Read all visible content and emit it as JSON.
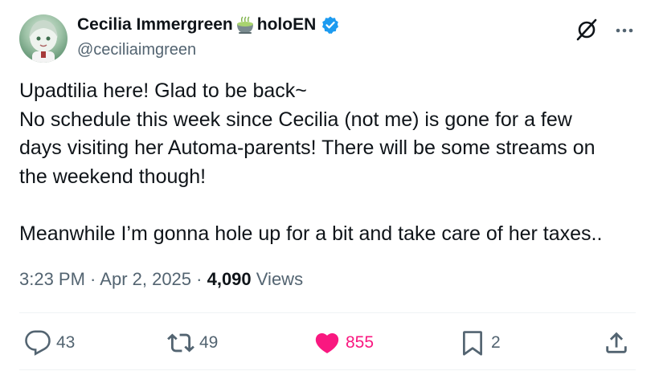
{
  "author": {
    "display_name_part1": "Cecilia Immergreen",
    "emoji": "green-tea-emoji",
    "display_name_part2": "holoEN",
    "handle": "@ceciliaimgreen",
    "verified": true
  },
  "header_icons": [
    "grok-icon",
    "more-icon"
  ],
  "tweet": {
    "lines": [
      "Upadtilia here! Glad to be back~",
      "No schedule this week since Cecilia (not me) is gone for a few",
      "days visiting her Automa-parents! There will be some streams on",
      "the weekend though!",
      "",
      "Meanwhile I’m gonna hole up for a bit and take care of her taxes.."
    ]
  },
  "meta": {
    "time": "3:23 PM",
    "separator": " · ",
    "date": "Apr 2, 2025",
    "views_count": "4,090",
    "views_label": "Views"
  },
  "actions": {
    "replies": "43",
    "reposts": "49",
    "likes": "855",
    "bookmarks": "2"
  },
  "colors": {
    "text": "#0f1419",
    "secondary": "#536471",
    "like": "#f91880",
    "verified": "#1d9bf0",
    "divider": "#eff3f4"
  }
}
